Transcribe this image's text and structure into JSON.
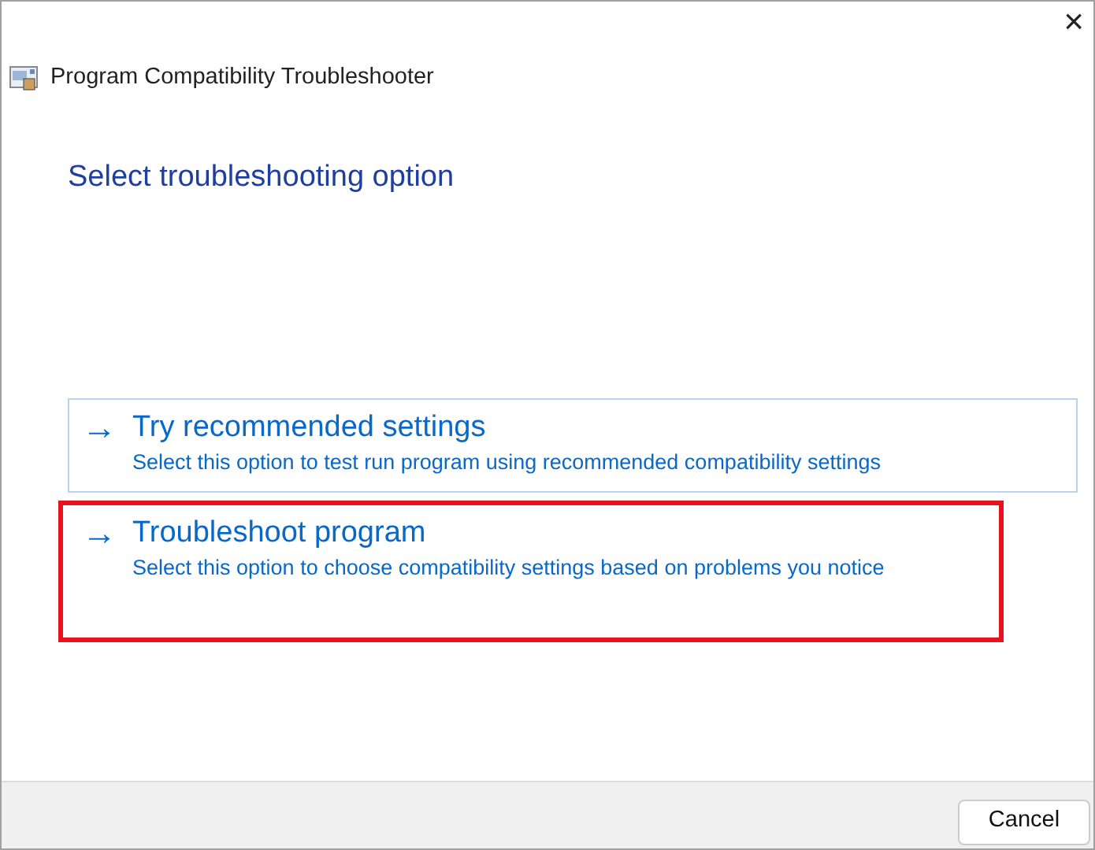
{
  "window": {
    "title": "Program Compatibility Troubleshooter",
    "close": "×"
  },
  "heading": "Select troubleshooting option",
  "options": [
    {
      "arrow": "→",
      "title": "Try recommended settings",
      "description": "Select this option to test run program using recommended compatibility settings",
      "selected": true,
      "annotated": false
    },
    {
      "arrow": "→",
      "title": "Troubleshoot program",
      "description": "Select this option to choose compatibility settings based on problems you notice",
      "selected": false,
      "annotated": true
    }
  ],
  "buttons": [
    "Cancel"
  ]
}
